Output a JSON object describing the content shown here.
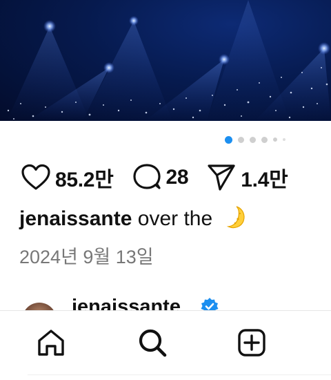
{
  "post": {
    "likes": "85.2만",
    "comments": "28",
    "shares": "1.4만",
    "caption_user": "jenaissante",
    "caption_text": " over the ",
    "caption_emoji": "crescent-moon-emoji",
    "date": "2024년 9월 13일"
  },
  "carousel": {
    "total_dots": 6,
    "active_index": 0
  },
  "comment_preview": {
    "username": "jenaissante",
    "verified": true
  },
  "icons": {
    "like": "heart-icon",
    "comment": "comment-bubble-icon",
    "share": "paper-plane-icon",
    "home": "home-icon",
    "search": "search-icon",
    "add": "add-post-icon"
  },
  "colors": {
    "accent": "#1c8ff0",
    "text": "#111111",
    "muted": "#777777",
    "photo_bg": "#061a4e"
  }
}
